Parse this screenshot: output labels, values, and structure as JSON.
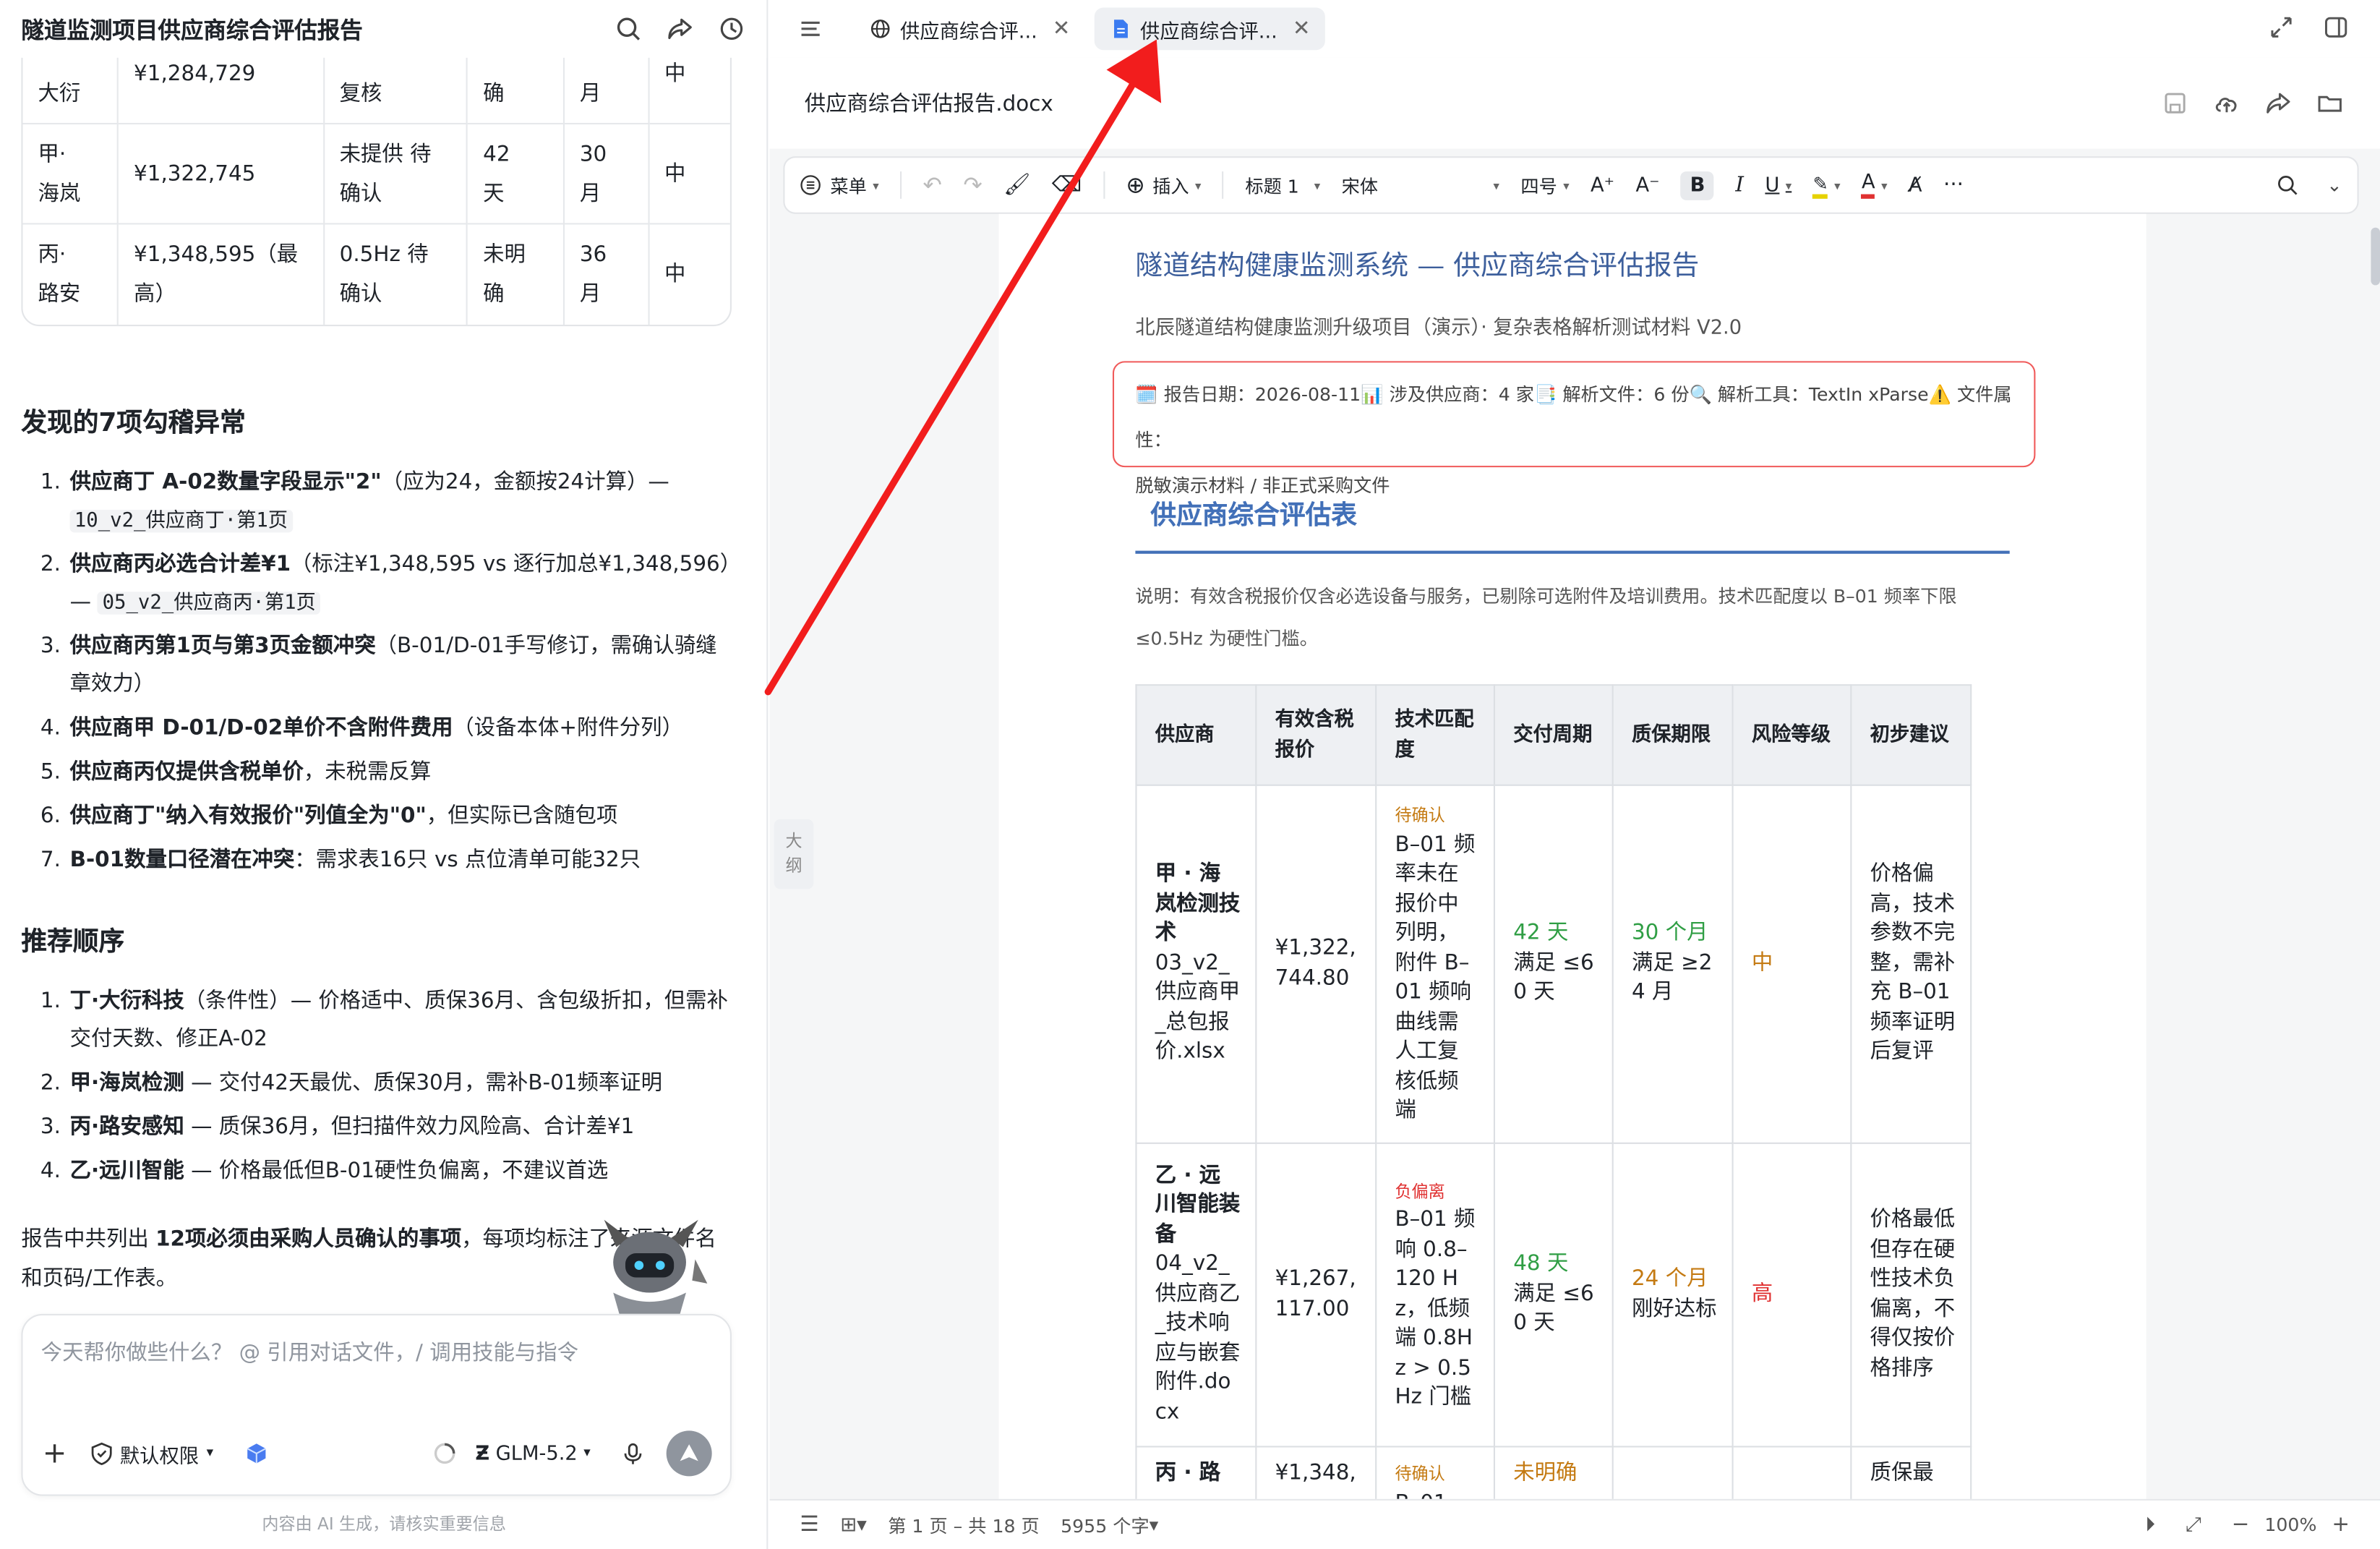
{
  "left": {
    "title": "隧道监测项目供应商综合评估报告",
    "preview_rows": [
      {
        "cells": [
          "大衍",
          "¥1,284,729",
          "复核",
          "确",
          "月",
          "中"
        ]
      },
      {
        "cells": [
          "甲·\n海岚",
          "¥1,322,745",
          "未提供 待\n确认",
          "42\n天",
          "30\n月",
          "中"
        ]
      },
      {
        "cells": [
          "丙·\n路安",
          "¥1,348,595（最\n高）",
          "0.5Hz 待\n确认",
          "未明\n确",
          "36\n月",
          "中"
        ]
      }
    ],
    "anomalies_title": "发现的7项勾稽异常",
    "anomalies": [
      {
        "num": "1.",
        "bold": "供应商丁 A-02数量字段显示\"2\"",
        "rest": "（应为24，金额按24计算）— ",
        "code": "10_v2_供应商丁·第1页"
      },
      {
        "num": "2.",
        "bold": "供应商丙必选合计差¥1",
        "rest": "（标注¥1,348,595 vs 逐行加总¥1,348,596）— ",
        "code": "05_v2_供应商丙·第1页"
      },
      {
        "num": "3.",
        "bold": "供应商丙第1页与第3页金额冲突",
        "rest": "（B-01/D-01手写修订，需确认骑缝章效力）",
        "code": ""
      },
      {
        "num": "4.",
        "bold": "供应商甲 D-01/D-02单价不含附件费用",
        "rest": "（设备本体+附件分列）",
        "code": ""
      },
      {
        "num": "5.",
        "bold": "供应商丙仅提供含税单价",
        "rest": "，未税需反算",
        "code": ""
      },
      {
        "num": "6.",
        "bold": "供应商丁\"纳入有效报价\"列值全为\"0\"",
        "rest": "，但实际已含随包项",
        "code": ""
      },
      {
        "num": "7.",
        "bold": "B-01数量口径潜在冲突",
        "rest": "：需求表16只 vs 点位清单可能32只",
        "code": ""
      }
    ],
    "recommend_title": "推荐顺序",
    "recommend": [
      {
        "num": "1.",
        "bold": "丁·大衍科技",
        "rest": "（条件性）— 价格适中、质保36月、含包级折扣，但需补交付天数、修正A-02"
      },
      {
        "num": "2.",
        "bold": "甲·海岚检测",
        "rest": " — 交付42天最优、质保30月，需补B-01频率证明"
      },
      {
        "num": "3.",
        "bold": "丙·路安感知",
        "rest": " — 质保36月，但扫描件效力风险高、合计差¥1"
      },
      {
        "num": "4.",
        "bold": "乙·远川智能",
        "rest": " — 价格最低但B-01硬性负偏离，不建议首选"
      }
    ],
    "summary_pre": "报告中共列出 ",
    "summary_bold": "12项必须由采购人员确认的事项",
    "summary_post": "，每项均标注了来源文件名和页码/工作表。",
    "input_placeholder": "今天帮你做些什么？ @ 引用对话文件，/ 调用技能与指令",
    "permission_label": "默认权限",
    "model_label": "GLM-5.2",
    "disclaimer": "内容由 AI 生成，请核实重要信息"
  },
  "right": {
    "tabs": [
      {
        "label": "供应商综合评...",
        "icon": "globe-icon",
        "active": false
      },
      {
        "label": "供应商综合评...",
        "icon": "doc-icon",
        "active": true
      }
    ],
    "filename": "供应商综合评估报告.docx",
    "toolbar": {
      "menu": "菜单",
      "insert": "插入",
      "heading": "标题 1",
      "font": "宋体",
      "size": "四号"
    },
    "outline_label": "大纲",
    "doc": {
      "title": "隧道结构健康监测系统 — 供应商综合评估报告",
      "subtitle": "北辰隧道结构健康监测升级项目（演示）· 复杂表格解析测试材料 V2.0",
      "info_line1": "🗓️ 报告日期：2026-08-11📊 涉及供应商：4 家📑 解析文件：6 份🔍 解析工具：TextIn xParse⚠️ 文件属性：",
      "info_line2": "脱敏演示材料 / 非正式采购文件",
      "section_title": "供应商综合评估表",
      "note": "说明：有效含税报价仅含必选设备与服务，已剔除可选附件及培训费用。技术匹配度以 B–01 频率下限≤0.5Hz 为硬性门槛。",
      "table_headers": [
        "供应商",
        "有效含税报价",
        "技术匹配度",
        "交付周期",
        "质保期限",
        "风险等级",
        "初步建议"
      ],
      "rows": [
        {
          "supplier": "甲 · 海岚检测技术",
          "file": "03_v2_供应商甲_总包报价.xlsx",
          "price": "¥1,322,744.80",
          "tech_tag": "待确认",
          "tech": "B–01 频率未在报价中列明，附件 B–01 频响曲线需人工复核低频端",
          "delivery_val": "42 天",
          "delivery_note": "满足 ≤60 天",
          "warranty_val": "30 个月",
          "warranty_note": "满足 ≥24 月",
          "risk": "中",
          "advice": "价格偏高，技术参数不完整，需补充 B–01 频率证明后复评"
        },
        {
          "supplier": "乙 · 远川智能装备",
          "file": "04_v2_供应商乙_技术响应与嵌套附件.docx",
          "price": "¥1,267,117.00",
          "tech_tag": "负偏离",
          "tech": "B–01 频响 0.8–120 Hz，低频端 0.8Hz > 0.5Hz 门槛",
          "delivery_val": "48 天",
          "delivery_note": "满足 ≤60 天",
          "warranty_val": "24 个月",
          "warranty_note": "刚好达标",
          "risk": "高",
          "advice": "价格最低但存在硬性技术负偏离，不得仅按价格排序"
        },
        {
          "supplier": "丙 · 路",
          "file": "",
          "price": "¥1,348,",
          "tech_tag": "待确认",
          "tech": "B–01",
          "delivery_val": "未明确",
          "delivery_note": "",
          "warranty_val": "",
          "warranty_note": "",
          "risk": "",
          "advice": "质保最"
        }
      ]
    },
    "status": {
      "page": "第 1 页 – 共 18 页",
      "words": "5955 个字",
      "zoom": "100%"
    },
    "colors": {
      "accent": "#4270b8",
      "warn": "#c47a12",
      "ok": "#2f9e44",
      "danger": "#e03131",
      "arrow": "#f21d1d"
    }
  }
}
